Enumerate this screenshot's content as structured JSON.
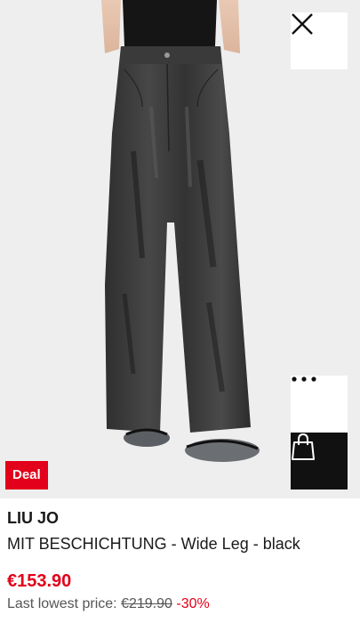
{
  "product": {
    "brand": "LIU JO",
    "name": "MIT BESCHICHTUNG - Wide Leg - black",
    "price": "€153.90",
    "last_price_label": "Last lowest price:",
    "old_price": "€219.90",
    "discount": "-30%"
  },
  "badges": {
    "deal": "Deal"
  },
  "icons": {
    "close": "close-icon",
    "more": "more-dots-icon",
    "bag": "shopping-bag-icon"
  },
  "colors": {
    "accent": "#e2001a",
    "bag_button_bg": "#111111",
    "image_bg": "#eeeeee"
  }
}
